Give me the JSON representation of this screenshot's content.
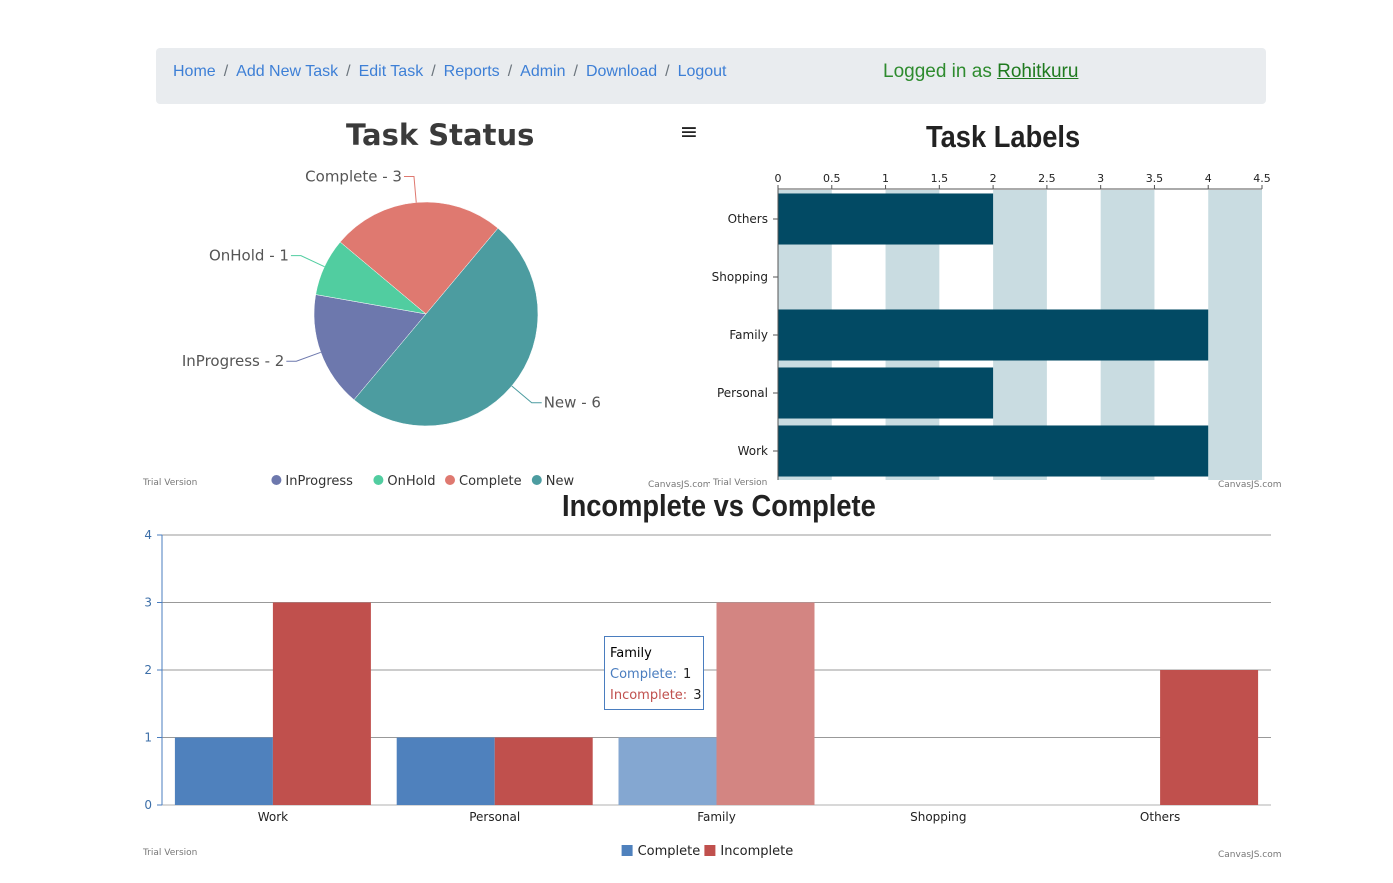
{
  "nav": {
    "items": [
      "Home",
      "Add New Task",
      "Edit Task",
      "Reports",
      "Admin",
      "Download",
      "Logout"
    ],
    "separator": "/",
    "login_prefix": "Logged in as",
    "username": "Rohitkuru"
  },
  "colors": {
    "link": "#3d7fd6",
    "login": "#2e8b2e",
    "navbar_bg": "#e9ecef",
    "bar_dark": "#024a64",
    "stripe": "#c9dce1",
    "complete": "#4f81bd",
    "incomplete": "#c0504d"
  },
  "menu_icon": "hamburger-menu-icon",
  "watermarks": {
    "trial": "Trial Version",
    "brand": "CanvasJS.com"
  },
  "chart_data": [
    {
      "type": "pie",
      "title": "Task Status",
      "slices": [
        {
          "name": "InProgress",
          "value": 2,
          "label": "InProgress - 2",
          "color": "#6d78ad"
        },
        {
          "name": "OnHold",
          "value": 1,
          "label": "OnHold - 1",
          "color": "#51cda0"
        },
        {
          "name": "Complete",
          "value": 3,
          "label": "Complete - 3",
          "color": "#df7970"
        },
        {
          "name": "New",
          "value": 6,
          "label": "New - 6",
          "color": "#4c9ca0"
        }
      ],
      "legend": [
        "InProgress",
        "OnHold",
        "Complete",
        "New"
      ],
      "legend_position": "bottom"
    },
    {
      "type": "bar",
      "orientation": "horizontal",
      "title": "Task Labels",
      "categories": [
        "Work",
        "Personal",
        "Family",
        "Shopping",
        "Others"
      ],
      "values": [
        4,
        2,
        4,
        0,
        2
      ],
      "xlim": [
        0,
        4.5
      ],
      "ticks": [
        "0",
        "0.5",
        "1",
        "1.5",
        "2",
        "2.5",
        "3",
        "3.5",
        "4",
        "4.5"
      ],
      "axis_position": "top",
      "color": "#024a64",
      "stripes": true
    },
    {
      "type": "bar",
      "title": "Incomplete vs Complete",
      "categories": [
        "Work",
        "Personal",
        "Family",
        "Shopping",
        "Others"
      ],
      "series": [
        {
          "name": "Complete",
          "values": [
            1,
            1,
            1,
            0,
            0
          ],
          "color": "#4f81bd"
        },
        {
          "name": "Incomplete",
          "values": [
            3,
            1,
            3,
            0,
            2
          ],
          "color": "#c0504d"
        }
      ],
      "ylim": [
        0,
        4
      ],
      "yticks": [
        "0",
        "1",
        "2",
        "3",
        "4"
      ],
      "grid": true,
      "legend_position": "bottom",
      "highlighted_category": "Family",
      "tooltip": {
        "title": "Family",
        "complete_label": "Complete:",
        "complete_value": "1",
        "incomplete_label": "Incomplete:",
        "incomplete_value": "3"
      }
    }
  ]
}
